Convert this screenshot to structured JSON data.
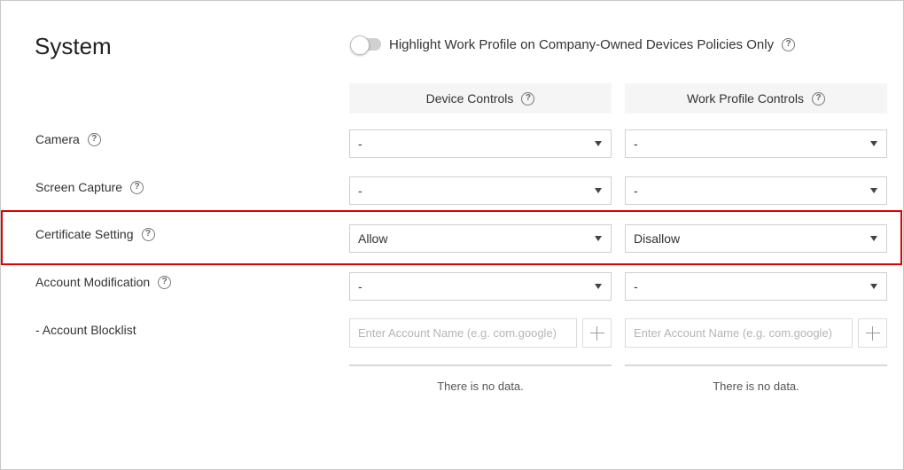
{
  "page": {
    "title": "System"
  },
  "highlight_toggle": {
    "label": "Highlight Work Profile on Company-Owned Devices Policies Only",
    "enabled": false
  },
  "columns": {
    "device": "Device Controls",
    "work": "Work Profile Controls"
  },
  "rows": {
    "camera": {
      "label": "Camera",
      "device_value": "-",
      "work_value": "-"
    },
    "screen_capture": {
      "label": "Screen Capture",
      "device_value": "-",
      "work_value": "-"
    },
    "certificate_setting": {
      "label": "Certificate Setting",
      "device_value": "Allow",
      "work_value": "Disallow"
    },
    "account_modification": {
      "label": "Account Modification",
      "device_value": "-",
      "work_value": "-"
    }
  },
  "account_blocklist": {
    "label": "- Account Blocklist",
    "placeholder": "Enter Account Name (e.g. com.google)",
    "empty_text": "There is no data."
  },
  "icons": {
    "help": "?"
  },
  "colors": {
    "highlight_border": "#e00000",
    "header_bg": "#f5f5f5"
  }
}
